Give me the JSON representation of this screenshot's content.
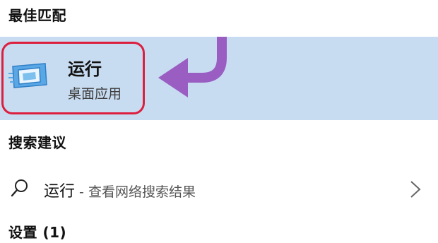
{
  "headings": {
    "best_match": "最佳匹配",
    "suggestions": "搜索建议",
    "settings": "设置 (1)"
  },
  "best_match": {
    "app_name": "运行",
    "app_type": "桌面应用"
  },
  "suggestion": {
    "query": "运行",
    "separator": " - ",
    "hint": "查看网络搜索结果"
  },
  "colors": {
    "selected_row_bg": "#c8dcf1",
    "highlight_border": "#dc1f3f",
    "arrow": "#9a5ec3"
  },
  "icons": {
    "app": "run-app-icon",
    "search": "search-icon",
    "chevron": "chevron-right-icon",
    "annotation": "curved-arrow-icon"
  }
}
